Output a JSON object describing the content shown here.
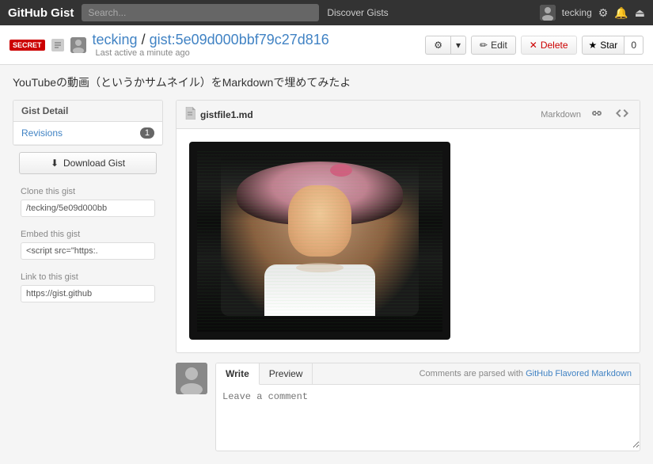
{
  "header": {
    "logo": "GitHub Gist",
    "search_placeholder": "Search...",
    "discover_label": "Discover Gists",
    "username": "tecking",
    "icons": [
      "settings",
      "notifications",
      "signout"
    ]
  },
  "subheader": {
    "secret_badge": "SECRET",
    "owner": "tecking",
    "gist_id": "gist:5e09d000bbf79c27d816",
    "last_active": "Last active a minute ago",
    "edit_label": "Edit",
    "delete_label": "Delete",
    "star_label": "Star",
    "star_count": "0",
    "settings_label": "▼"
  },
  "page": {
    "title": "YouTubeの動画（というかサムネイル）をMarkdownで埋めてみたよ"
  },
  "sidebar": {
    "box_title": "Gist Detail",
    "revisions_label": "Revisions",
    "revisions_count": "1",
    "download_label": "Download Gist",
    "clone_label": "Clone this gist",
    "clone_value": "/tecking/5e09d000bb",
    "embed_label": "Embed this gist",
    "embed_value": "<script src=\"https:.",
    "link_label": "Link to this gist",
    "link_value": "https://gist.github"
  },
  "file": {
    "icon": "📄",
    "name": "gistfile1.md",
    "type": "Markdown",
    "link_icon": "🔗",
    "code_icon": "<>"
  },
  "comment": {
    "write_tab": "Write",
    "preview_tab": "Preview",
    "hint_text": "Comments are parsed with",
    "hint_link": "GitHub Flavored Markdown"
  }
}
